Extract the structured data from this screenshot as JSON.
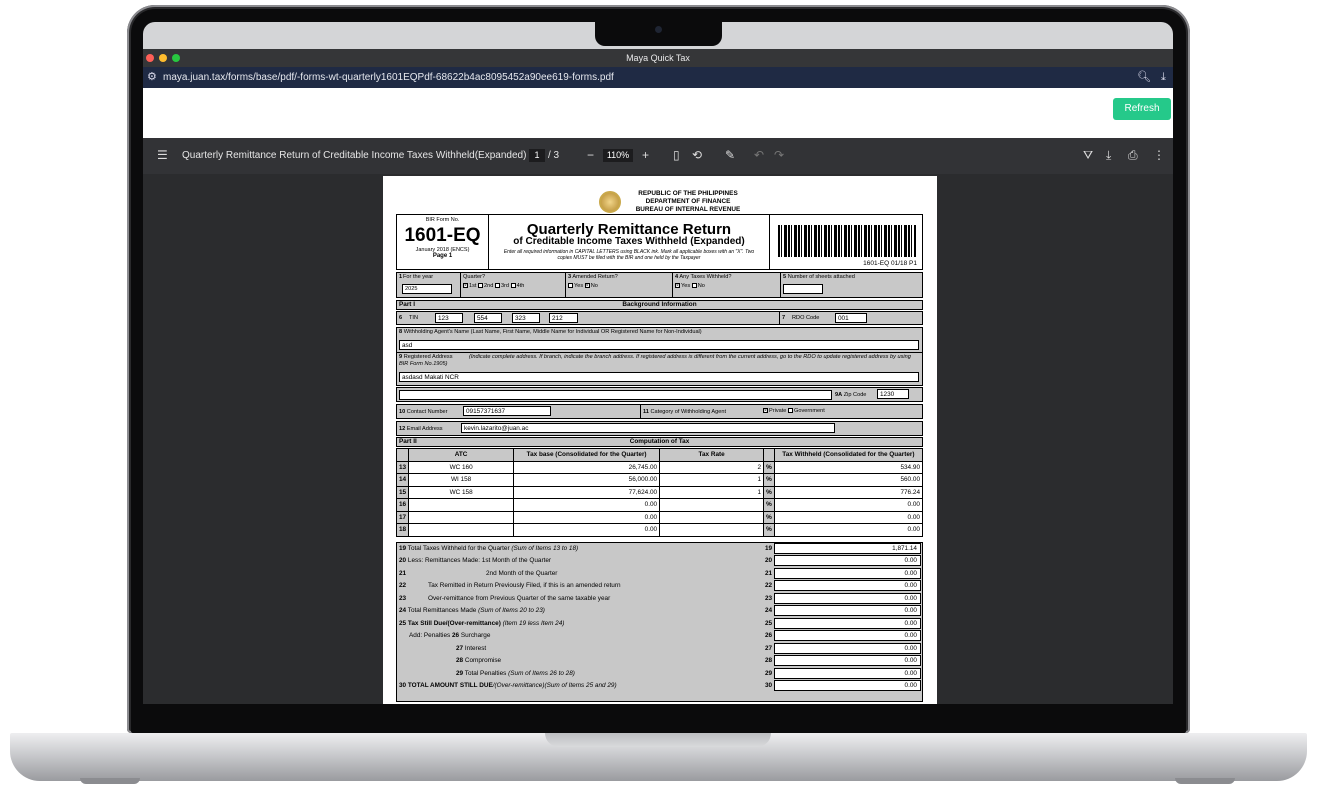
{
  "window": {
    "title": "Maya Quick Tax"
  },
  "address_bar": {
    "url": "maya.juan.tax/forms/base/pdf/-forms-wt-quarterly1601EQPdf-68622b4ac8095452a90ee619-forms.pdf"
  },
  "app": {
    "refresh_label": "Refresh"
  },
  "viewer": {
    "doc_title": "Quarterly Remittance Return of Creditable Income Taxes Withheld(Expanded)",
    "current_page": "1",
    "total_pages": "/  3",
    "zoom": "110%"
  },
  "form": {
    "header": {
      "republic": "REPUBLIC OF THE PHILIPPINES",
      "dept": "DEPARTMENT OF FINANCE",
      "bureau": "BUREAU OF INTERNAL REVENUE",
      "form_label": "BIR Form No.",
      "form_no": "1601-EQ",
      "form_date": "January 2018 (ENCS)",
      "page": "Page 1",
      "title1": "Quarterly Remittance Return",
      "title2": "of Creditable Income Taxes Withheld (Expanded)",
      "instructions": "Enter all required information in CAPITAL LETTERS using BLACK ink. Mark all applicable boxes with an \"X\". Two copies MUST be filed with the BIR and one held by the Taxpayer",
      "barcode_text": "1601-EQ 01/18 P1"
    },
    "row1": {
      "for_year_label": "For the year",
      "for_year": "2025",
      "quarter_label": "Quarter?",
      "q1": "1st",
      "q2": "2nd",
      "q3": "3rd",
      "q4": "4th",
      "amended_label": "Amended Return?",
      "yes": "Yes",
      "no": "No",
      "any_taxes_label": "Any Taxes Withheld?",
      "sheets_label": "Number of sheets attached"
    },
    "part1": {
      "part": "Part I",
      "title": "Background Information"
    },
    "tin": {
      "label": "TIN",
      "a": "123",
      "b": "554",
      "c": "323",
      "d": "212",
      "rdo_label": "RDO Code",
      "rdo": "001"
    },
    "agent_name": {
      "label": "Withholding Agent's Name (Last Name, First Name, Middle Name for Individual OR Registered Name for Non-Individual)",
      "value": "asd"
    },
    "address": {
      "label": "Registered Address",
      "note": "(Indicate complete address. If branch, indicate the branch address. If registered address is different from the current address, go to the RDO to update registered address by using BIR Form No.1905)",
      "value": "asdasd Makati NCR",
      "zip_label": "Zip Code",
      "zip": "1230"
    },
    "contact": {
      "label": "Contact Number",
      "value": "09157371637",
      "category_label": "Category of Withholding Agent",
      "private": "Private",
      "government": "Government"
    },
    "email": {
      "label": "Email Address",
      "value": "kevin.lazarito@juan.ac"
    },
    "part2": {
      "part": "Part II",
      "title": "Computation of Tax"
    },
    "comp_headers": {
      "atc": "ATC",
      "base": "Tax base (Consolidated for the Quarter)",
      "rate": "Tax Rate",
      "withheld": "Tax Withheld (Consolidated for the Quarter)"
    },
    "comp_rows": [
      {
        "no": "13",
        "atc": "WC 160",
        "base": "26,745.00",
        "rate": "2",
        "pct": "%",
        "withheld": "534.90"
      },
      {
        "no": "14",
        "atc": "WI 158",
        "base": "56,000.00",
        "rate": "1",
        "pct": "%",
        "withheld": "560.00"
      },
      {
        "no": "15",
        "atc": "WC 158",
        "base": "77,624.00",
        "rate": "1",
        "pct": "%",
        "withheld": "776.24"
      },
      {
        "no": "16",
        "atc": "",
        "base": "0.00",
        "rate": "",
        "pct": "%",
        "withheld": "0.00"
      },
      {
        "no": "17",
        "atc": "",
        "base": "0.00",
        "rate": "",
        "pct": "%",
        "withheld": "0.00"
      },
      {
        "no": "18",
        "atc": "",
        "base": "0.00",
        "rate": "",
        "pct": "%",
        "withheld": "0.00"
      }
    ],
    "summary": [
      {
        "no": "19",
        "label": "Total Taxes Withheld for the Quarter",
        "note": "(Sum of Items 13 to 18)",
        "value": "1,871.14"
      },
      {
        "no": "20",
        "label": "Less: Remittances Made: 1st Month of the Quarter",
        "note": "",
        "value": "0.00"
      },
      {
        "no": "21",
        "label": "2nd Month of the Quarter",
        "note": "",
        "value": "0.00"
      },
      {
        "no": "22",
        "label": "Tax Remitted in Return Previously Filed, if this is an amended return",
        "note": "",
        "value": "0.00"
      },
      {
        "no": "23",
        "label": "Over-remittance from Previous Quarter of the same taxable year",
        "note": "",
        "value": "0.00"
      },
      {
        "no": "24",
        "label": "Total Remittances Made",
        "note": "(Sum of Items 20 to 23)",
        "value": "0.00"
      },
      {
        "no": "25",
        "label": "Tax Still Due/(Over-remittance)",
        "note": "(Item 19 less Item 24)",
        "value": "0.00"
      },
      {
        "no": "26",
        "label": "Surcharge",
        "prefix": "Add: Penalties",
        "note": "",
        "value": "0.00"
      },
      {
        "no": "27",
        "label": "Interest",
        "note": "",
        "value": "0.00"
      },
      {
        "no": "28",
        "label": "Compromise",
        "note": "",
        "value": "0.00"
      },
      {
        "no": "29",
        "label": "Total Penalties",
        "note": "(Sum of Items 26 to 28)",
        "value": "0.00"
      },
      {
        "no": "30",
        "label": "TOTAL AMOUNT STILL DUE",
        "note": "/(Over-remittance)(Sum of Items 25 and 29)",
        "value": "0.00"
      }
    ]
  }
}
